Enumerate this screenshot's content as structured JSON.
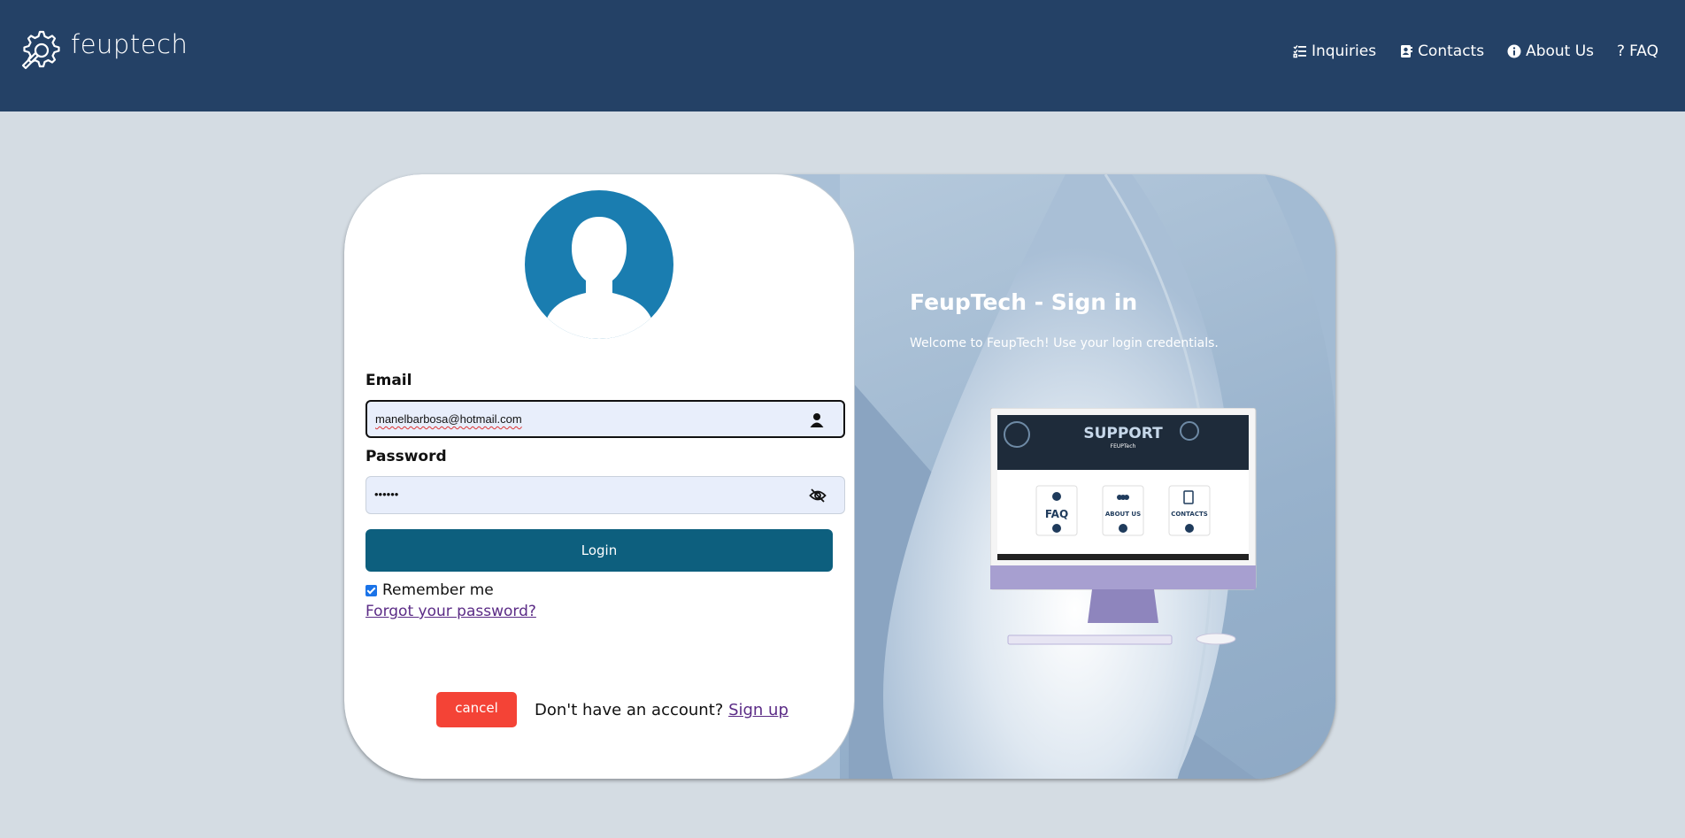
{
  "header": {
    "brand": "feuptech",
    "nav": [
      {
        "label": "Inquiries",
        "icon": "checklist-icon"
      },
      {
        "label": "Contacts",
        "icon": "contact-card-icon"
      },
      {
        "label": "About Us",
        "icon": "info-icon"
      },
      {
        "label": "FAQ",
        "icon": "question-icon"
      }
    ]
  },
  "form": {
    "email_label": "Email",
    "email_value": "manelbarbosa@hotmail.com",
    "password_label": "Password",
    "password_value": "••••••",
    "login_label": "Login",
    "remember_label": "Remember me",
    "remember_checked": true,
    "forgot_label": "Forgot your password?",
    "cancel_label": "cancel",
    "no_account_text": "Don't have an account?",
    "signup_label": "Sign up"
  },
  "panel": {
    "title": "FeupTech - Sign in",
    "subtitle": "Welcome to FeupTech! Use your login credentials."
  },
  "preview": {
    "banner": "SUPPORT",
    "banner_brand": "FEUPTech",
    "tiles": [
      "FAQ",
      "ABOUT US",
      "CONTACTS"
    ]
  },
  "colors": {
    "header_bg": "#244166",
    "page_bg": "#d4dce3",
    "login_button": "#0d5f7e",
    "cancel_button": "#f44336",
    "avatar": "#1a7db0"
  }
}
